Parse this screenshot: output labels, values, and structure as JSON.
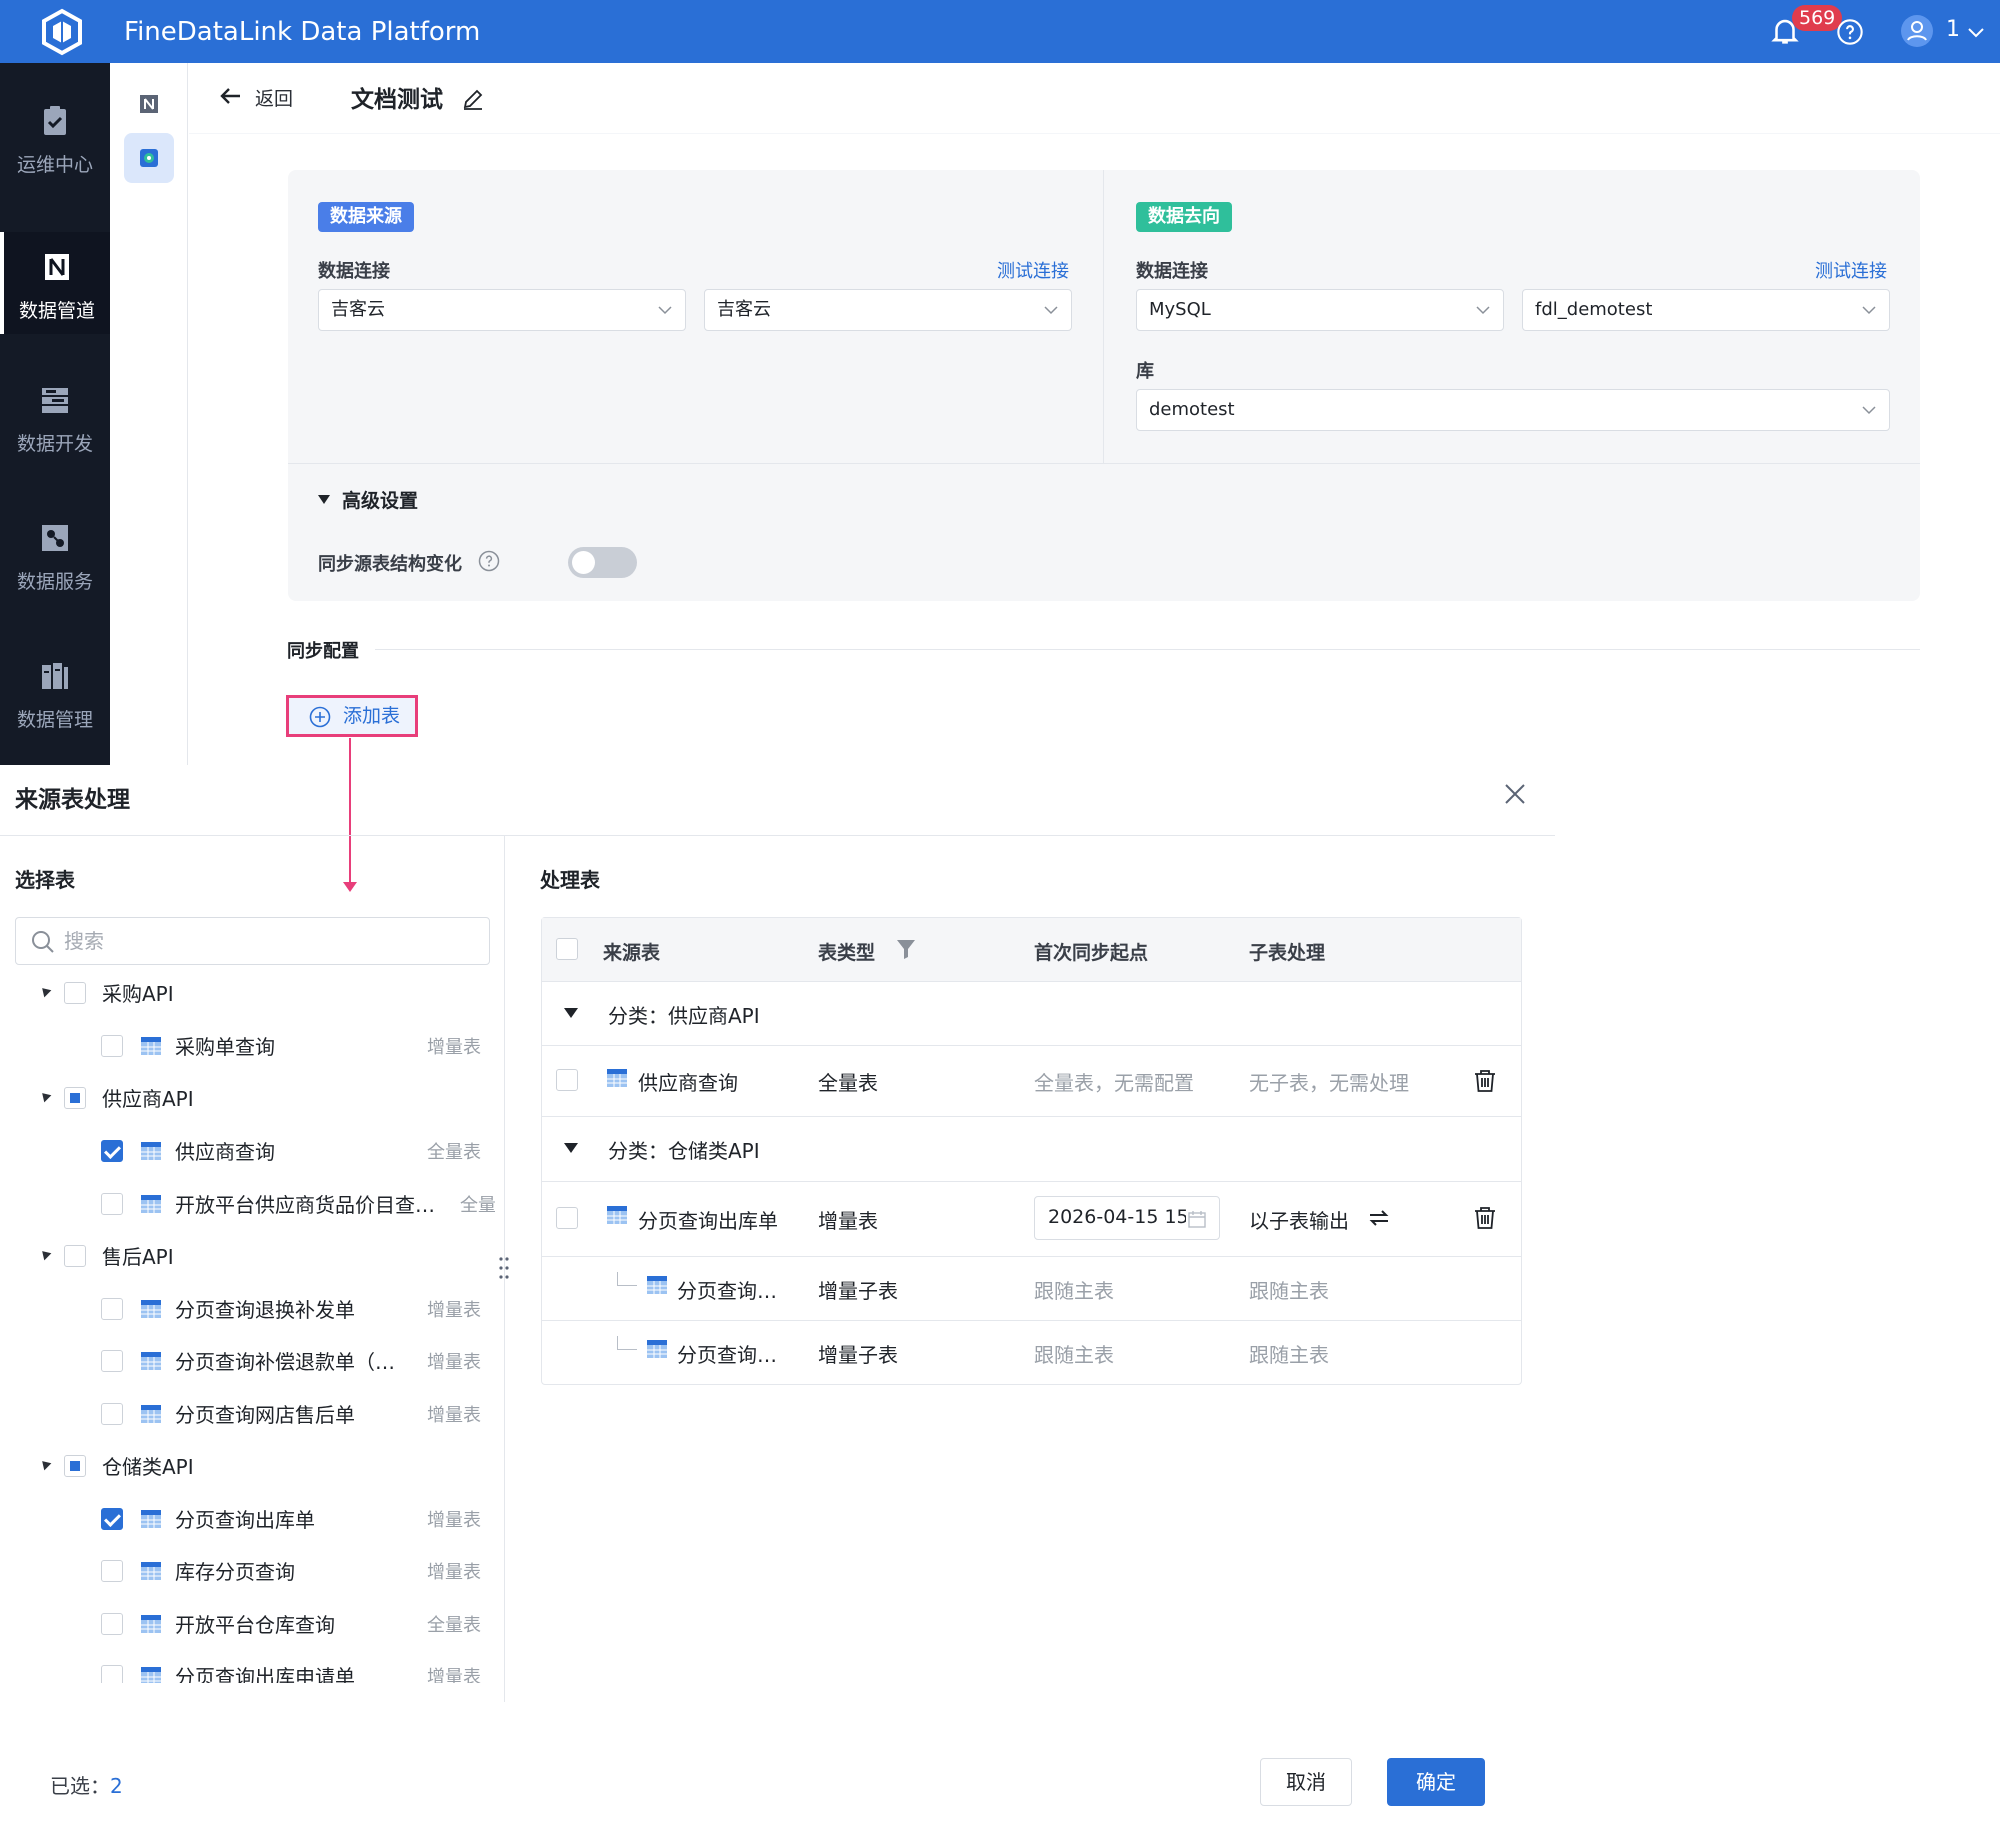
{
  "app": {
    "title": "FineDataLink Data Platform",
    "notifications": "569",
    "user": "1"
  },
  "sidebar": {
    "items": [
      {
        "label": "运维中心",
        "icon": "clipboard-check-icon"
      },
      {
        "label": "数据管道",
        "icon": "pipeline-icon",
        "active": true
      },
      {
        "label": "数据开发",
        "icon": "dev-icon"
      },
      {
        "label": "数据服务",
        "icon": "service-icon"
      },
      {
        "label": "数据管理",
        "icon": "manage-icon"
      }
    ]
  },
  "header": {
    "back_label": "返回",
    "title": "文档测试"
  },
  "source": {
    "tag": "数据来源",
    "conn_label": "数据连接",
    "test_link": "测试连接",
    "conn_value": "吉客云",
    "conn_value2": "吉客云"
  },
  "target": {
    "tag": "数据去向",
    "conn_label": "数据连接",
    "test_link": "测试连接",
    "conn_value": "MySQL",
    "conn_value2": "fdl_demotest",
    "db_label": "库",
    "db_value": "demotest"
  },
  "advanced": {
    "label": "高级设置",
    "sync_label": "同步源表结构变化",
    "sync_on": false
  },
  "sync_config": {
    "label": "同步配置",
    "add_table": "添加表"
  },
  "dialog": {
    "title": "来源表处理",
    "left_title": "选择表",
    "search_placeholder": "搜索",
    "tree": [
      {
        "level": 0,
        "label": "采购API",
        "state": "none"
      },
      {
        "level": 1,
        "label": "采购单查询",
        "type": "增量表",
        "state": "none"
      },
      {
        "level": 0,
        "label": "供应商API",
        "state": "partial"
      },
      {
        "level": 1,
        "label": "供应商查询",
        "type": "全量表",
        "state": "checked"
      },
      {
        "level": 1,
        "label": "开放平台供应商货品价目查…",
        "type": "全量表",
        "state": "none"
      },
      {
        "level": 0,
        "label": "售后API",
        "state": "none"
      },
      {
        "level": 1,
        "label": "分页查询退换补发单",
        "type": "增量表",
        "state": "none"
      },
      {
        "level": 1,
        "label": "分页查询补偿退款单（…",
        "type": "增量表",
        "state": "none"
      },
      {
        "level": 1,
        "label": "分页查询网店售后单",
        "type": "增量表",
        "state": "none"
      },
      {
        "level": 0,
        "label": "仓储类API",
        "state": "partial"
      },
      {
        "level": 1,
        "label": "分页查询出库单",
        "type": "增量表",
        "state": "checked"
      },
      {
        "level": 1,
        "label": "库存分页查询",
        "type": "增量表",
        "state": "none"
      },
      {
        "level": 1,
        "label": "开放平台仓库查询",
        "type": "全量表",
        "state": "none"
      },
      {
        "level": 1,
        "label": "分页查询出库申请单",
        "type": "增量表",
        "state": "none"
      }
    ],
    "right_title": "处理表",
    "columns": [
      "来源表",
      "表类型",
      "首次同步起点",
      "子表处理"
    ],
    "categories": [
      {
        "label": "分类：供应商API"
      },
      {
        "label": "分类：仓储类API"
      }
    ],
    "rows": [
      {
        "name": "供应商查询",
        "type": "全量表",
        "start": "全量表，无需配置",
        "child": "无子表，无需处理"
      },
      {
        "name": "分页查询出库单",
        "type": "增量表",
        "start": "2026-04-15 15",
        "child": "以子表输出"
      },
      {
        "name": "分页查询…",
        "type": "增量子表",
        "start": "跟随主表",
        "child": "跟随主表"
      },
      {
        "name": "分页查询…",
        "type": "增量子表",
        "start": "跟随主表",
        "child": "跟随主表"
      }
    ],
    "selected_label": "已选：",
    "selected_count": "2",
    "cancel": "取消",
    "ok": "确定"
  }
}
